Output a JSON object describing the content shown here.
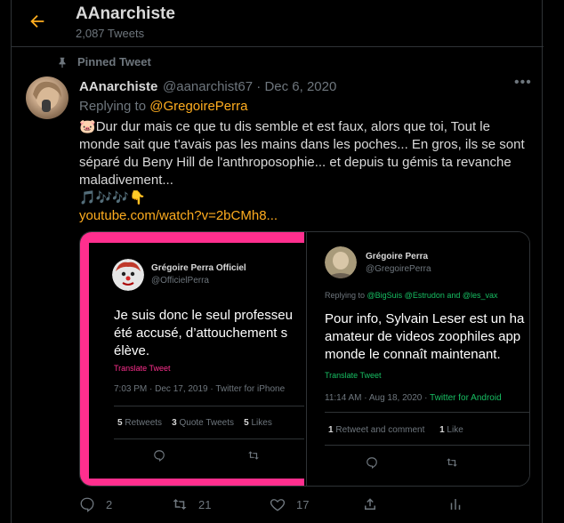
{
  "header": {
    "title": "AAnarchiste",
    "tweet_count": "2,087 Tweets"
  },
  "pinned_label": "Pinned Tweet",
  "tweet": {
    "display_name": "AAnarchiste",
    "meta": "@aanarchist67 · Dec 6, 2020",
    "replying_prefix": "Replying to ",
    "replying_to": "@GregoirePerra",
    "text": "Dur dur mais ce que tu dis semble et est faux, alors que toi, Tout le monde sait que t'avais pas les mains dans les poches... En gros, ils se sont séparé du Beny Hill de l'anthroposophie... et depuis tu gémis ta revanche maladivement...",
    "lead_emoji": "🐷",
    "emoji_line": "🎵🎶🎶👇",
    "link": "youtube.com/watch?v=2bCMh8..."
  },
  "quote1": {
    "name": "Grégoire Perra Officiel",
    "handle": "@OfficielPerra",
    "line1": "Je suis donc le seul professeu",
    "line2": "été accusé, d’attouchement s",
    "line3": "élève.",
    "translate": "Translate Tweet",
    "date": "7:03 PM · Dec 17, 2019 · Twitter for iPhone",
    "retweets_num": "5",
    "retweets_label": "Retweets",
    "quotes_num": "3",
    "quotes_label": "Quote Tweets",
    "likes_num": "5",
    "likes_label": "Likes"
  },
  "quote2": {
    "name": "Grégoire Perra",
    "handle": "@GregoirePerra",
    "replying_prefix": "Replying to ",
    "replying_users": "@BigSuis @Estrudon and @les_vax",
    "line1": "Pour info, Sylvain Leser est un ha",
    "line2": "amateur de videos zoophiles app",
    "line3": "monde le connaît maintenant.",
    "translate": "Translate Tweet",
    "date": "11:14 AM · Aug 18, 2020 · ",
    "via": "Twitter for Android",
    "retweet_stats_num": "1",
    "retweet_stats_label": "Retweet and comment",
    "like_stats_num": "1",
    "like_stats_label": "Like"
  },
  "actions": {
    "replies": "2",
    "retweets": "21",
    "likes": "17"
  },
  "colors": {
    "accent": "#ffad1f",
    "pink": "#ff2f8e",
    "green": "#17bf63",
    "muted": "#6e767d"
  }
}
